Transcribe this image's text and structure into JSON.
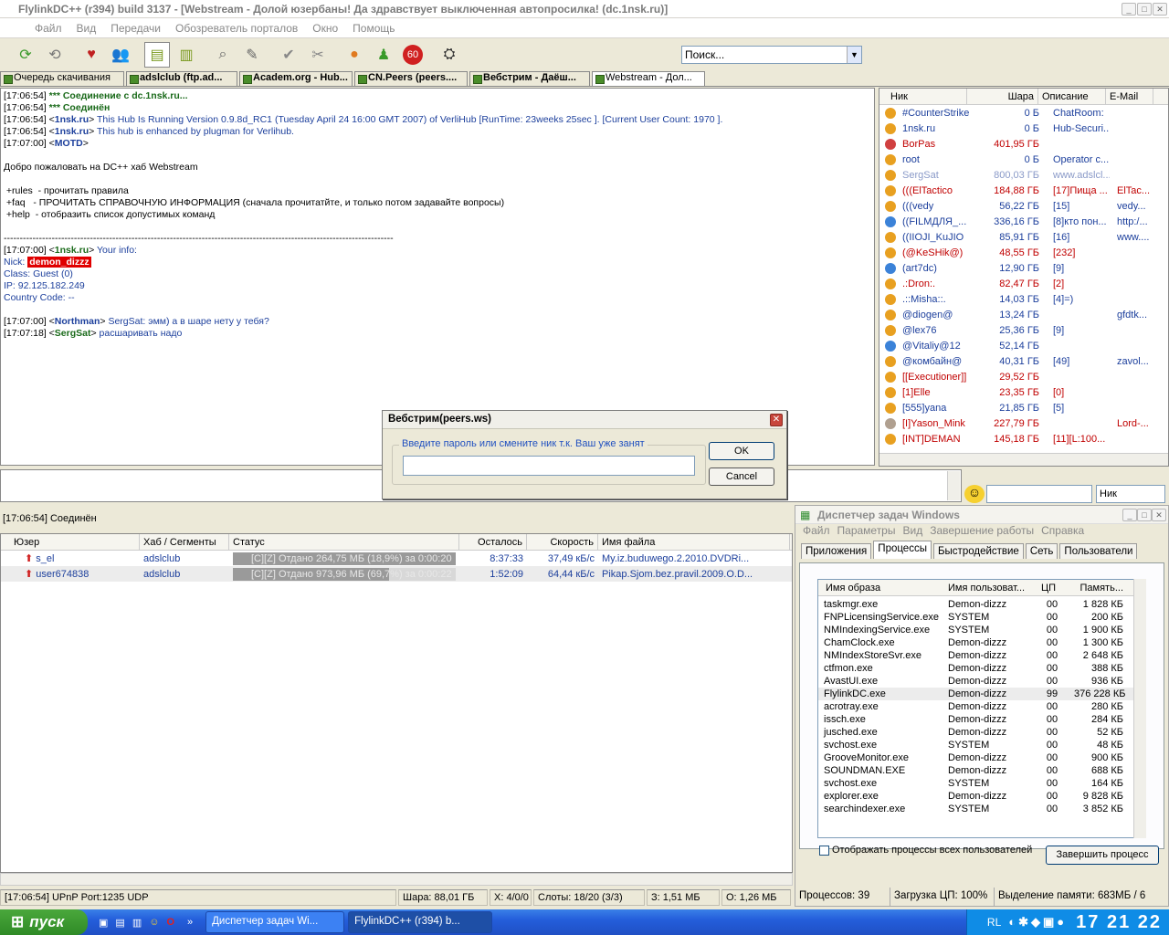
{
  "window": {
    "title": "FlylinkDC++ (r394) build 3137 - [Webstream -  Долой юзербаны! Да здравствует выключенная автопросилка! (dc.1nsk.ru)]"
  },
  "menu": [
    "Файл",
    "Вид",
    "Передачи",
    "Обозреватель порталов",
    "Окно",
    "Помощь"
  ],
  "toolbar": {
    "search_placeholder": "Поиск...",
    "badge": "60"
  },
  "tabs": [
    "Очередь скачивания",
    "adslclub (ftp.ad...",
    "Academ.org - Hub...",
    "CN.Peers (peers....",
    "Вебстрим -  Даёш...",
    "Webstream -  Дол..."
  ],
  "chat": {
    "l1": {
      "ts": "[17:06:54]",
      "text": "*** Соединение с dc.1nsk.ru..."
    },
    "l2": {
      "ts": "[17:06:54]",
      "text": "*** Соединён"
    },
    "l3": {
      "ts": "[17:06:54]",
      "nick": "1nsk.ru",
      "text": "This Hub Is Running Version 0.9.8d_RC1 (Tuesday April 24 16:00 GMT 2007) of VerliHub [RunTime: 23weeks 25sec ]. [Current User Count: 1970 ]."
    },
    "l4": {
      "ts": "[17:06:54]",
      "nick": "1nsk.ru",
      "text": "This hub is enhanced by plugman for Verlihub."
    },
    "l5": {
      "ts": "[17:07:00]",
      "nick": "MOTD"
    },
    "welcome": "Добро пожаловать на DC++ хаб Webstream",
    "rules": " +rules  - прочитать правила",
    "faq": " +faq   - ПРОЧИТАТЬ СПРАВОЧНУЮ ИНФОРМАЦИЯ (сначала прочитатйте, и только потом задавайте вопросы)",
    "help": " +help  - отобразить список допустимых команд",
    "sep": "--------------------------------------------------------------------------------------------------------------------------",
    "info_ts": "[17:07:00]",
    "info_nick": "1nsk.ru",
    "info_text": "Your info:",
    "nick_label": "Nick:",
    "nick_val": "demon_dizzz",
    "class": "Class: Guest (0)",
    "ip": "IP: 92.125.182.249",
    "country": "Country Code: --",
    "m1": {
      "ts": "[17:07:00]",
      "nick": "Northman",
      "text": "SergSat: эмм) а в шаре нету у тебя?"
    },
    "m2": {
      "ts": "[17:07:18]",
      "nick": "SergSat",
      "text": "расшаривать надо"
    }
  },
  "users": {
    "headers": [
      "Ник",
      "Шара",
      "Описание",
      "E-Mail"
    ],
    "rows": [
      {
        "nick": "#CounterStrike",
        "share": "0 Б",
        "desc": "ChatRoom:",
        "email": "",
        "color": "#1c3f9c",
        "icon": "#e8a020"
      },
      {
        "nick": "1nsk.ru",
        "share": "0 Б",
        "desc": "Hub-Securi...",
        "email": "",
        "color": "#1c3f9c",
        "icon": "#e8a020"
      },
      {
        "nick": "BorPas",
        "share": "401,95 ГБ",
        "desc": "",
        "email": "",
        "color": "#c00000",
        "icon": "#d04040"
      },
      {
        "nick": "root",
        "share": "0 Б",
        "desc": "Operator c...",
        "email": "",
        "color": "#1c3f9c",
        "icon": "#e8a020"
      },
      {
        "nick": "SergSat",
        "share": "800,03 ГБ",
        "desc": "www.adslcl...",
        "email": "",
        "color": "#8a9ac8",
        "icon": "#e8a020"
      },
      {
        "nick": "(((ElTactico",
        "share": "184,88 ГБ",
        "desc": "[17]Пища ...",
        "email": "ElTac...",
        "color": "#c00000",
        "icon": "#e8a020"
      },
      {
        "nick": "(((vedy",
        "share": "56,22 ГБ",
        "desc": "[15]",
        "email": "vedy...",
        "color": "#1c3f9c",
        "icon": "#e8a020"
      },
      {
        "nick": "((FILMДЛЯ_...",
        "share": "336,16 ГБ",
        "desc": "[8]кто пон...",
        "email": "http:/...",
        "color": "#1c3f9c",
        "icon": "#3b82d8"
      },
      {
        "nick": "((IIOJI_KuJIO",
        "share": "85,91 ГБ",
        "desc": "[16]",
        "email": "www....",
        "color": "#1c3f9c",
        "icon": "#e8a020"
      },
      {
        "nick": "(@KeSHik@)",
        "share": "48,55 ГБ",
        "desc": "[232]",
        "email": "",
        "color": "#c00000",
        "icon": "#e8a020"
      },
      {
        "nick": "(art7dc)",
        "share": "12,90 ГБ",
        "desc": "[9]",
        "email": "",
        "color": "#1c3f9c",
        "icon": "#3b82d8"
      },
      {
        "nick": ".:Dron:.",
        "share": "82,47 ГБ",
        "desc": "[2]",
        "email": "",
        "color": "#c00000",
        "icon": "#e8a020"
      },
      {
        "nick": ".::Misha::.",
        "share": "14,03 ГБ",
        "desc": "[4]=)",
        "email": "",
        "color": "#1c3f9c",
        "icon": "#e8a020"
      },
      {
        "nick": "@diogen@",
        "share": "13,24 ГБ",
        "desc": "",
        "email": "gfdtk...",
        "color": "#1c3f9c",
        "icon": "#e8a020"
      },
      {
        "nick": "@lex76",
        "share": "25,36 ГБ",
        "desc": "[9]",
        "email": "",
        "color": "#1c3f9c",
        "icon": "#e8a020"
      },
      {
        "nick": "@Vitaliy@12",
        "share": "52,14 ГБ",
        "desc": "",
        "email": "",
        "color": "#1c3f9c",
        "icon": "#3b82d8"
      },
      {
        "nick": "@комбайн@",
        "share": "40,31 ГБ",
        "desc": "[49]",
        "email": "zavol...",
        "color": "#1c3f9c",
        "icon": "#e8a020"
      },
      {
        "nick": "[[Executioner]]",
        "share": "29,52 ГБ",
        "desc": "",
        "email": "",
        "color": "#c00000",
        "icon": "#e8a020"
      },
      {
        "nick": "[1]Elle",
        "share": "23,35 ГБ",
        "desc": "[0]",
        "email": "",
        "color": "#c00000",
        "icon": "#e8a020"
      },
      {
        "nick": "[555]yana",
        "share": "21,85 ГБ",
        "desc": "[5]",
        "email": "",
        "color": "#1c3f9c",
        "icon": "#e8a020"
      },
      {
        "nick": "[I]Yason_Mink",
        "share": "227,79 ГБ",
        "desc": "",
        "email": "Lord-...",
        "color": "#c00000",
        "icon": "#b0a090"
      },
      {
        "nick": "[INT]DEMAN",
        "share": "145,18 ГБ",
        "desc": "[11][L:100...",
        "email": "",
        "color": "#c00000",
        "icon": "#e8a020"
      }
    ]
  },
  "nick_combo": "Ник",
  "status_conn": "[17:06:54] Соединён",
  "transfers": {
    "headers": [
      "Юзер",
      "Хаб / Сегменты",
      "Статус",
      "Осталось",
      "Скорость",
      "Имя файла"
    ],
    "rows": [
      {
        "user": "s_el",
        "hub": "adslclub",
        "status": "[C][Z] Отдано 264,75 МБ (18,9%) за 0:00:20",
        "left": "8:37:33",
        "speed": "37,49 кБ/с",
        "file": "My.iz.buduwego.2.2010.DVDRi..."
      },
      {
        "user": "user674838",
        "hub": "adslclub",
        "status": "[C][Z] Отдано 973,96 МБ (69,7%) за 0:00:22",
        "left": "1:52:09",
        "speed": "64,44 кБ/с",
        "file": "Pikap.Sjom.bez.pravil.2009.O.D..."
      }
    ]
  },
  "statusbar": [
    "[17:06:54] UPnP Port:1235 UDP",
    "Шара: 88,01 ГБ",
    "Х: 4/0/0",
    "Слоты: 18/20 (3/3)",
    "З: 1,51 МБ",
    "О: 1,26 МБ"
  ],
  "dialog": {
    "title": "Вебстрим(peers.ws)",
    "group": "Введите пароль или смените ник т.к. Ваш уже занят",
    "ok": "OK",
    "cancel": "Cancel"
  },
  "taskmgr": {
    "title": "Диспетчер задач Windows",
    "menu": [
      "Файл",
      "Параметры",
      "Вид",
      "Завершение работы",
      "Справка"
    ],
    "tabs": [
      "Приложения",
      "Процессы",
      "Быстродействие",
      "Сеть",
      "Пользователи"
    ],
    "headers": [
      "Имя образа",
      "Имя пользоват...",
      "ЦП",
      "Память..."
    ],
    "rows": [
      [
        "taskmgr.exe",
        "Demon-dizzz",
        "00",
        "1 828 КБ"
      ],
      [
        "FNPLicensingService.exe",
        "SYSTEM",
        "00",
        "200 КБ"
      ],
      [
        "NMIndexingService.exe",
        "SYSTEM",
        "00",
        "1 900 КБ"
      ],
      [
        "ChamClock.exe",
        "Demon-dizzz",
        "00",
        "1 300 КБ"
      ],
      [
        "NMIndexStoreSvr.exe",
        "Demon-dizzz",
        "00",
        "2 648 КБ"
      ],
      [
        "ctfmon.exe",
        "Demon-dizzz",
        "00",
        "388 КБ"
      ],
      [
        "AvastUI.exe",
        "Demon-dizzz",
        "00",
        "936 КБ"
      ],
      [
        "FlylinkDC.exe",
        "Demon-dizzz",
        "99",
        "376 228 КБ"
      ],
      [
        "acrotray.exe",
        "Demon-dizzz",
        "00",
        "280 КБ"
      ],
      [
        "issch.exe",
        "Demon-dizzz",
        "00",
        "284 КБ"
      ],
      [
        "jusched.exe",
        "Demon-dizzz",
        "00",
        "52 КБ"
      ],
      [
        "svchost.exe",
        "SYSTEM",
        "00",
        "48 КБ"
      ],
      [
        "GrooveMonitor.exe",
        "Demon-dizzz",
        "00",
        "900 КБ"
      ],
      [
        "SOUNDMAN.EXE",
        "Demon-dizzz",
        "00",
        "688 КБ"
      ],
      [
        "svchost.exe",
        "SYSTEM",
        "00",
        "164 КБ"
      ],
      [
        "explorer.exe",
        "Demon-dizzz",
        "00",
        "9 828 КБ"
      ],
      [
        "searchindexer.exe",
        "SYSTEM",
        "00",
        "3 852 КБ"
      ]
    ],
    "show_all": "Отображать процессы всех пользователей",
    "end_btn": "Завершить процесс",
    "status": [
      "Процессов: 39",
      "Загрузка ЦП: 100%",
      "Выделение памяти: 683МБ / 6"
    ]
  },
  "taskbar": {
    "start": "пуск",
    "btn1": "Диспетчер задач Wi...",
    "btn2": "FlylinkDC++ (r394) b...",
    "lang": "RL",
    "clock": "17 21 22"
  }
}
